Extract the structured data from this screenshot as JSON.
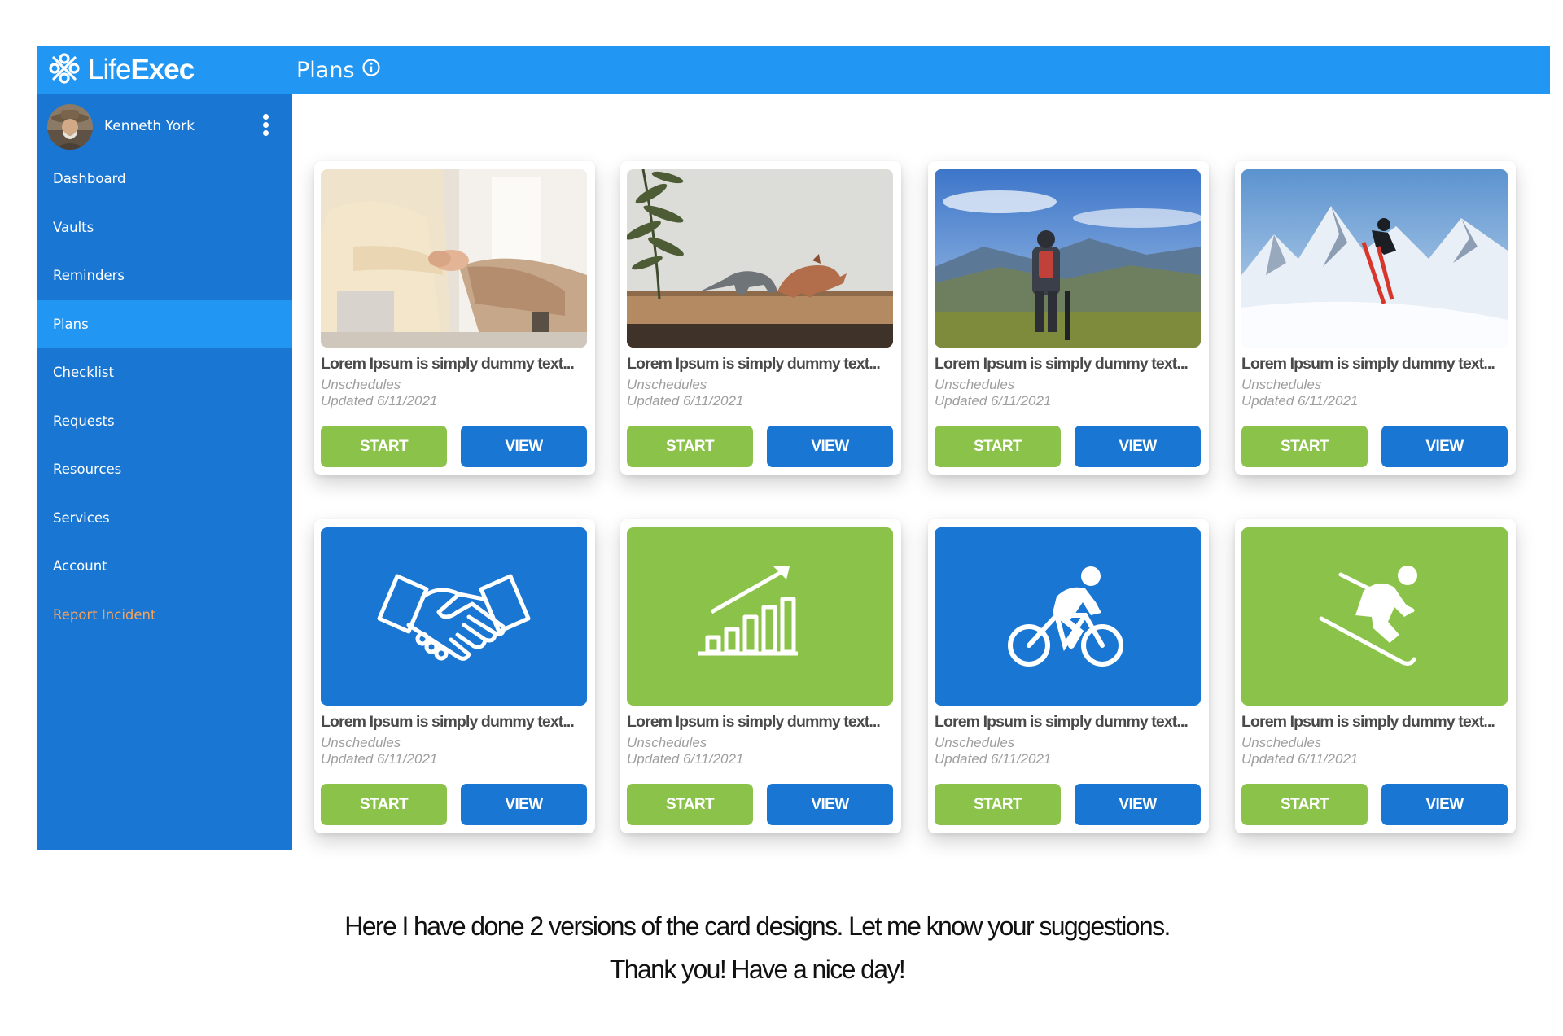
{
  "brand": {
    "logo_light": "Life",
    "logo_bold": "Exec",
    "icon": "lifeexec-logo-icon"
  },
  "header": {
    "title": "Plans",
    "info_icon": "info-icon"
  },
  "user": {
    "name": "Kenneth York",
    "menu_icon": "more-vert-icon"
  },
  "sidebar": {
    "items": [
      {
        "label": "Dashboard"
      },
      {
        "label": "Vaults"
      },
      {
        "label": "Reminders"
      },
      {
        "label": "Plans",
        "active": true
      },
      {
        "label": "Checklist"
      },
      {
        "label": "Requests"
      },
      {
        "label": "Resources"
      },
      {
        "label": "Services"
      },
      {
        "label": "Account"
      },
      {
        "label": "Report Incident",
        "color": "#f5a35c"
      }
    ]
  },
  "cards": [
    {
      "media": "photo-handshake",
      "title": "Lorem Ipsum is simply dummy text...",
      "subtitle": "Unschedules",
      "updated": "Updated 6/11/2021",
      "start": "START",
      "view": "VIEW"
    },
    {
      "media": "photo-dinosaurs",
      "title": "Lorem Ipsum is simply dummy text...",
      "subtitle": "Unschedules",
      "updated": "Updated 6/11/2021",
      "start": "START",
      "view": "VIEW"
    },
    {
      "media": "photo-cyclist-mountains",
      "title": "Lorem Ipsum is simply dummy text...",
      "subtitle": "Unschedules",
      "updated": "Updated 6/11/2021",
      "start": "START",
      "view": "VIEW"
    },
    {
      "media": "photo-skier-jump",
      "title": "Lorem Ipsum is simply dummy text...",
      "subtitle": "Unschedules",
      "updated": "Updated 6/11/2021",
      "start": "START",
      "view": "VIEW"
    },
    {
      "media": "handshake-icon",
      "bg": "#1976d2",
      "title": "Lorem Ipsum is simply dummy text...",
      "subtitle": "Unschedules",
      "updated": "Updated 6/11/2021",
      "start": "START",
      "view": "VIEW"
    },
    {
      "media": "growth-chart-icon",
      "bg": "#8bc34a",
      "title": "Lorem Ipsum is simply dummy text...",
      "subtitle": "Unschedules",
      "updated": "Updated 6/11/2021",
      "start": "START",
      "view": "VIEW"
    },
    {
      "media": "cyclist-icon",
      "bg": "#1976d2",
      "title": "Lorem Ipsum is simply dummy text...",
      "subtitle": "Unschedules",
      "updated": "Updated 6/11/2021",
      "start": "START",
      "view": "VIEW"
    },
    {
      "media": "skier-icon",
      "bg": "#8bc34a",
      "title": "Lorem Ipsum is simply dummy text...",
      "subtitle": "Unschedules",
      "updated": "Updated 6/11/2021",
      "start": "START",
      "view": "VIEW"
    }
  ],
  "note": {
    "line1": "Here I have done 2 versions of the card designs. Let me know your suggestions.",
    "line2": "Thank you! Have a nice day!"
  },
  "colors": {
    "topbar": "#2196f3",
    "sidebar": "#1976d2",
    "start": "#8bc34a",
    "view": "#1976d2",
    "incident": "#f5a35c"
  }
}
